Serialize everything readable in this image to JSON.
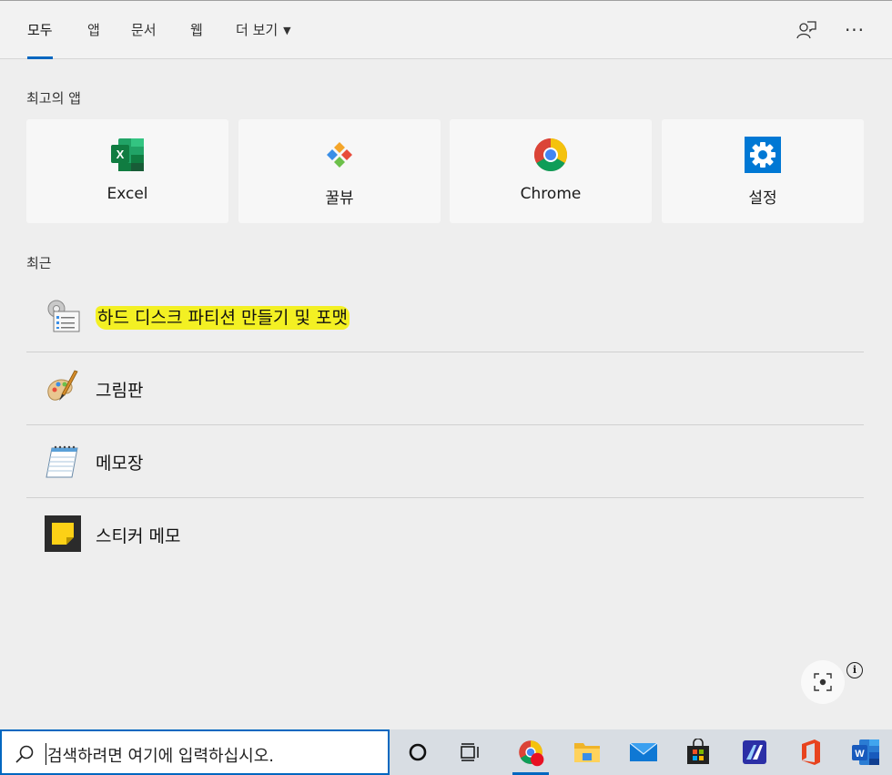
{
  "tabs": [
    {
      "label": "모두"
    },
    {
      "label": "앱"
    },
    {
      "label": "문서"
    },
    {
      "label": "웹"
    },
    {
      "label": "더 보기"
    }
  ],
  "more_caret": "▼",
  "top_icons": {
    "feedback": "feedback-icon",
    "more": "···"
  },
  "best_apps": {
    "title": "최고의 앱",
    "items": [
      {
        "label": "Excel",
        "icon": "excel-icon"
      },
      {
        "label": "꿀뷰",
        "icon": "honeyview-icon"
      },
      {
        "label": "Chrome",
        "icon": "chrome-icon"
      },
      {
        "label": "설정",
        "icon": "settings-gear-icon"
      }
    ]
  },
  "recent": {
    "title": "최근",
    "items": [
      {
        "label": "하드 디스크 파티션 만들기 및 포맷",
        "icon": "computer-management-icon",
        "highlighted": true
      },
      {
        "label": "그림판",
        "icon": "paint-icon"
      },
      {
        "label": "메모장",
        "icon": "notepad-icon"
      },
      {
        "label": "스티커 메모",
        "icon": "sticky-notes-icon"
      }
    ]
  },
  "info_glyph": "i",
  "search": {
    "placeholder": "검색하려면 여기에 입력하십시오."
  },
  "colors": {
    "accent": "#0067c0",
    "highlight": "#f3f023"
  },
  "taskbar_apps": [
    "cortana-icon",
    "task-view-icon",
    "chrome-icon",
    "file-explorer-icon",
    "mail-icon",
    "store-icon",
    "powerautomate-icon",
    "office-icon",
    "word-icon"
  ]
}
